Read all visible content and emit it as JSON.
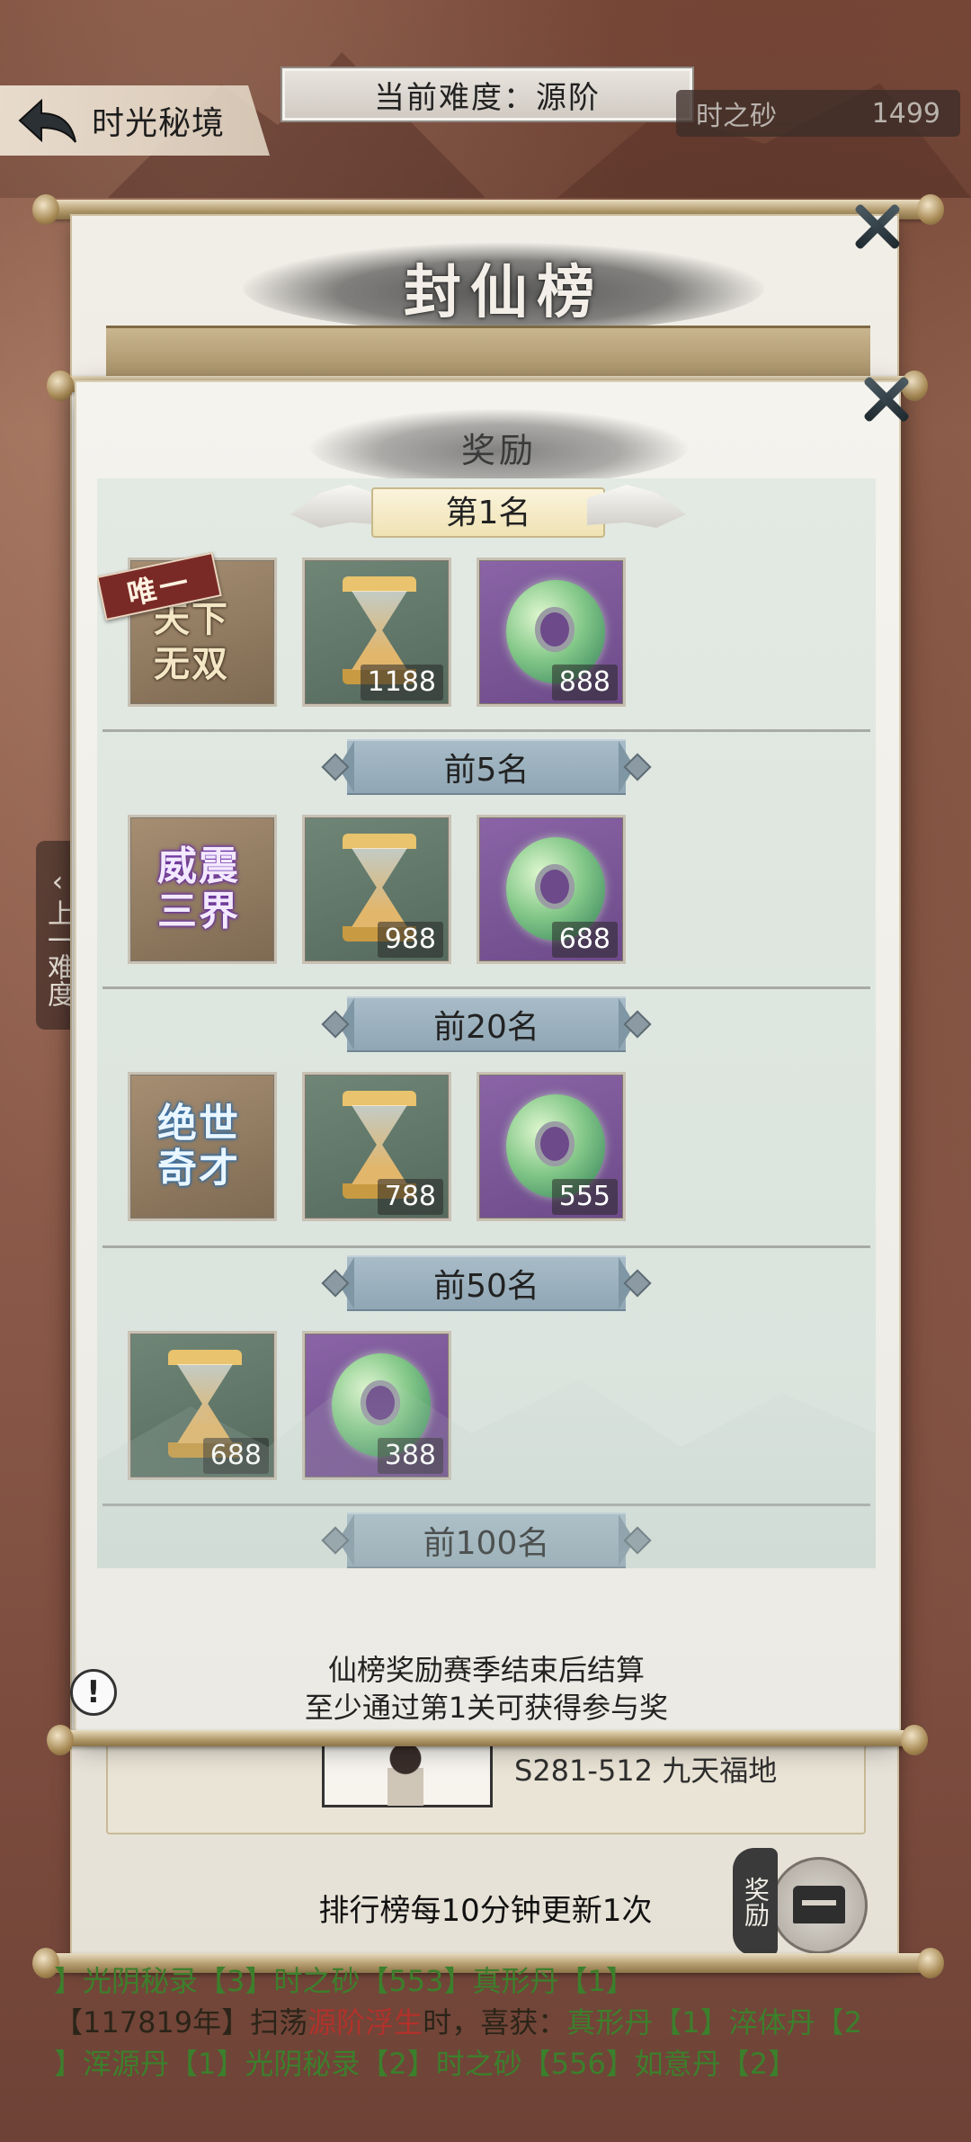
{
  "header": {
    "back_label": "时光秘境",
    "difficulty": "当前难度：源阶",
    "currency_name": "时之砂",
    "currency_amount": "1499"
  },
  "side": {
    "prev_difficulty": "上一难度"
  },
  "leaderboard": {
    "title": "封仙榜",
    "server_entry": "S281-512 九天福地",
    "update_note": "排行榜每10分钟更新1次",
    "reward_button_label": "奖励"
  },
  "reward_modal": {
    "title": "奖励",
    "tiers": [
      {
        "rank": "第1名",
        "items": [
          {
            "type": "title",
            "name": "天下无双",
            "ribbon": "唯一"
          },
          {
            "type": "hourglass",
            "count": "1188"
          },
          {
            "type": "jade",
            "count": "888"
          }
        ]
      },
      {
        "rank": "前5名",
        "items": [
          {
            "type": "title",
            "name": "威震三界"
          },
          {
            "type": "hourglass",
            "count": "988"
          },
          {
            "type": "jade",
            "count": "688"
          }
        ]
      },
      {
        "rank": "前20名",
        "items": [
          {
            "type": "title",
            "name": "绝世奇才"
          },
          {
            "type": "hourglass",
            "count": "788"
          },
          {
            "type": "jade",
            "count": "555"
          }
        ]
      },
      {
        "rank": "前50名",
        "items": [
          {
            "type": "hourglass",
            "count": "688"
          },
          {
            "type": "jade",
            "count": "388"
          }
        ]
      },
      {
        "rank": "前100名",
        "items": []
      }
    ],
    "footer_line1": "仙榜奖励赛季结束后结算",
    "footer_line2": "至少通过第1关可获得参与奖"
  },
  "log": {
    "line1": "】光阴秘录【3】时之砂【553】真形丹【1】",
    "line2_prefix": "【117819年】扫荡",
    "line2_highlight": "源阶浮生",
    "line2_mid": "时，喜获：",
    "line2_items": "真形丹【1】淬体丹【2",
    "line3": "】浑源丹【1】光阴秘录【2】时之砂【556】如意丹【2】"
  },
  "colors": {
    "modal_bg": "#f5f3ee",
    "rank_banner": "#a8bcc8",
    "item_tan": "#a68e72",
    "item_green": "#6f8677",
    "item_purple": "#8a64a6",
    "log_green": "#3c7f2c",
    "log_red": "#b0322b"
  },
  "icons": [
    "back-arrow-icon",
    "close-icon",
    "warning-icon",
    "chest-icon",
    "hourglass-icon",
    "jade-icon"
  ]
}
